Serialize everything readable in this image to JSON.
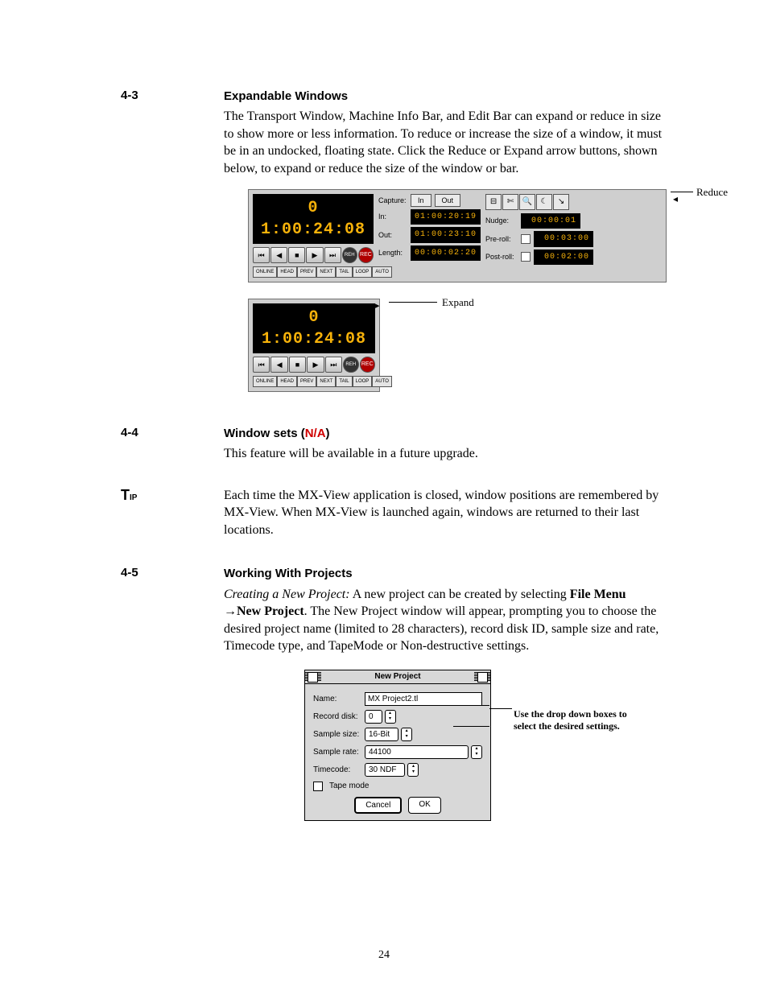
{
  "page_number": "24",
  "sections": {
    "s43": {
      "num": "4-3",
      "title": "Expandable Windows",
      "para": "The Transport Window, Machine Info Bar, and Edit Bar can expand or reduce in size to show more or less information. To reduce or increase the size of a window, it must be in an undocked, floating state. Click the Reduce or Expand arrow buttons, shown below, to expand or reduce the size of the window or bar."
    },
    "s44": {
      "num": "4-4",
      "title_a": "Window sets (",
      "title_na": "N/A",
      "title_b": ")",
      "para": "This feature will be available in a future upgrade."
    },
    "tip": {
      "label_big": "T",
      "label_small": "IP",
      "para": "Each time the MX-View application is closed, window positions are remembered by MX-View.  When MX-View is launched again, windows are returned to their last locations."
    },
    "s45": {
      "num": "4-5",
      "title": "Working With Projects",
      "para_lead_i": "Creating a New Project:",
      "para_a": " A new project can be created by selecting ",
      "para_b1": "File Menu ",
      "para_arrow": "→",
      "para_b2": "New Project",
      "para_c": ". The New Project window will appear, prompting you to choose the desired project name (limited to 28 characters), record disk ID, sample size and rate, Timecode type, and TapeMode or Non-destructive settings."
    }
  },
  "transport": {
    "timecode": "0 1:00:24:08",
    "modes": [
      "ONLINE",
      "HEAD",
      "PREV",
      "NEXT",
      "TAIL",
      "LOOP",
      "AUTO"
    ],
    "capture_label": "Capture:",
    "in_btn": "In",
    "out_btn": "Out",
    "in_label": "In:",
    "out_label": "Out:",
    "length_label": "Length:",
    "in_val": "01:00:20:19",
    "out_val": "01:00:23:10",
    "length_val": "00:00:02:20",
    "nudge_label": "Nudge:",
    "pre_label": "Pre-roll:",
    "post_label": "Post-roll:",
    "nudge_val": "00:00:01",
    "pre_val": "00:03:00",
    "post_val": "00:02:00",
    "reduce_callout": "Reduce",
    "expand_callout": "Expand",
    "btn_reh": "REH",
    "btn_rec": "REC",
    "tool_icons": [
      "⊟",
      "✄",
      "🔍",
      "☾",
      "↘"
    ]
  },
  "new_project": {
    "title": "New Project",
    "name_label": "Name:",
    "name_val": "MX Project2.tl",
    "rec_label": "Record disk:",
    "rec_val": "0",
    "ss_label": "Sample size:",
    "ss_val": "16-Bit",
    "sr_label": "Sample rate:",
    "sr_val": "44100",
    "tc_label": "Timecode:",
    "tc_val": "30 NDF",
    "tape_label": "Tape mode",
    "cancel": "Cancel",
    "ok": "OK",
    "callout": "Use the drop down boxes to select the desired settings."
  }
}
